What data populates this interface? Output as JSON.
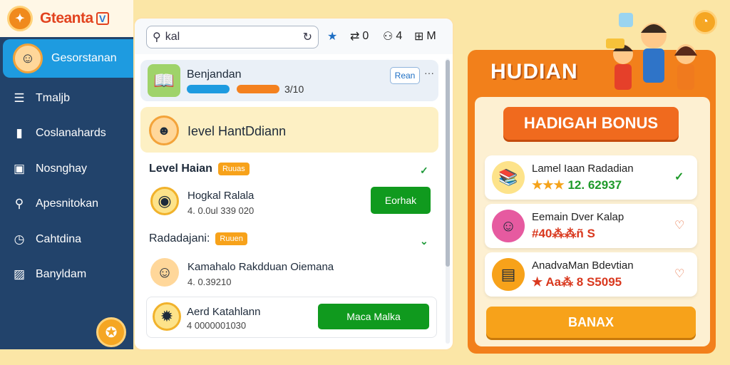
{
  "app": {
    "logo_text": "Gteanta",
    "logo_check": "V"
  },
  "sidebar": {
    "active": {
      "label": "Gesorstanan"
    },
    "items": [
      {
        "label": "Tmaljb",
        "icon": "list-icon"
      },
      {
        "label": "Coslanahards",
        "icon": "book-icon"
      },
      {
        "label": "Nosnghay",
        "icon": "calendar-icon"
      },
      {
        "label": "Apesnitokan",
        "icon": "search-icon"
      },
      {
        "label": "Cahtdina",
        "icon": "clock-icon"
      },
      {
        "label": "Banyldam",
        "icon": "chart-icon"
      }
    ]
  },
  "toolbar": {
    "search_value": "kal",
    "stat1": "0",
    "stat2": "4",
    "stat3": "M"
  },
  "card1": {
    "title": "Benjandan",
    "count": "3/10",
    "read_label": "Rean",
    "more": "···"
  },
  "card2": {
    "title": "Ievel HantDdiann"
  },
  "section1": {
    "title": "Level Haian",
    "tag": "Ruuas"
  },
  "row1": {
    "title": "Hogkal Ralala",
    "sub": "4. 0.0ul 339 020",
    "button": "Eorhak"
  },
  "section2": {
    "title": "Radadajani:",
    "tag": "Ruuen"
  },
  "row2": {
    "title": "Kamahalo Rakdduan Oiemana",
    "sub": "4. 0.39210"
  },
  "row3": {
    "title": "Aerd Katahlann",
    "sub": "4 0000001030",
    "button": "Maca Malka"
  },
  "right": {
    "title": "HUDIAN",
    "banner": "HADIGAH BONUS",
    "rewards": [
      {
        "title": "Lamel  Iaan Radadian",
        "value": "12. 62937",
        "stars": "★★★",
        "action": "check"
      },
      {
        "title": "Eemain Dver Kalap",
        "value": "#40⁂⁂ñ S",
        "stars": "",
        "action": "heart"
      },
      {
        "title": "AnadvaMan Bdevtian",
        "value": "★ Aa⁂ 8 S5095",
        "stars": "★",
        "action": "heart"
      }
    ],
    "button": "BANAX"
  },
  "colors": {
    "accent": "#f2801b",
    "primary": "#1e9be0",
    "sidebar": "#22436b",
    "success": "#109a1e"
  }
}
